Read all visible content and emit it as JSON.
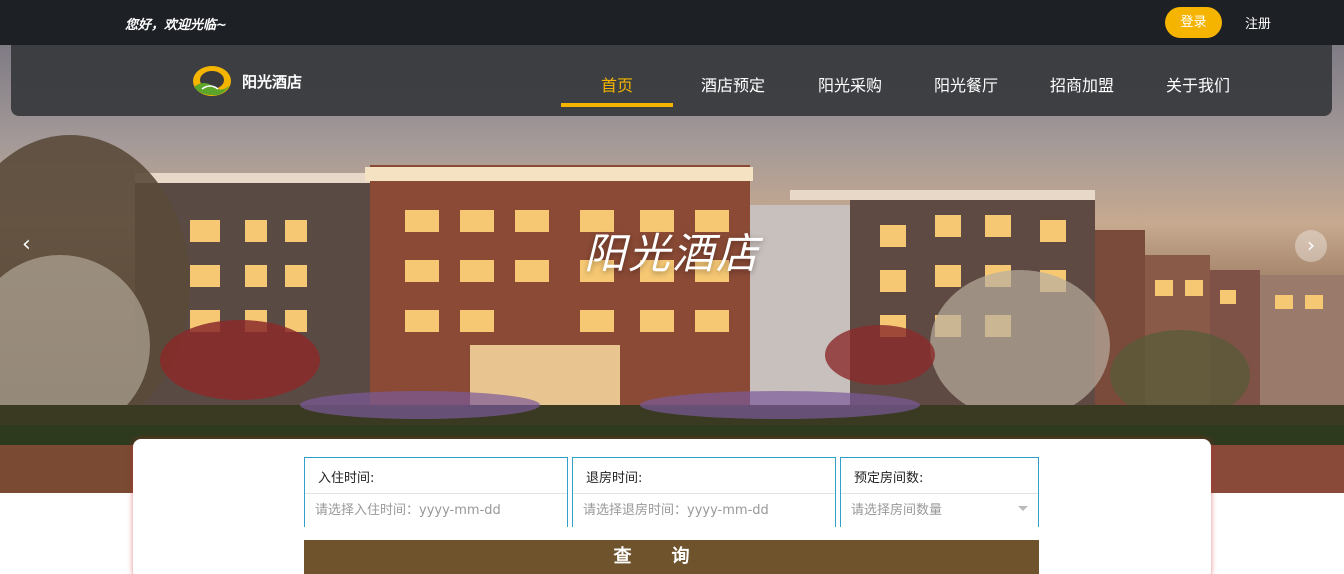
{
  "topbar": {
    "welcome": "您好，欢迎光临~",
    "login_label": "登录",
    "register_label": "注册"
  },
  "brand": {
    "name": "阳光酒店"
  },
  "nav": {
    "items": [
      {
        "label": "首页",
        "active": true
      },
      {
        "label": "酒店预定",
        "active": false
      },
      {
        "label": "阳光采购",
        "active": false
      },
      {
        "label": "阳光餐厅",
        "active": false
      },
      {
        "label": "招商加盟",
        "active": false
      },
      {
        "label": "关于我们",
        "active": false
      }
    ]
  },
  "hero": {
    "title": "阳光酒店",
    "prev_icon": "chevron-left-icon",
    "next_icon": "chevron-right-icon"
  },
  "search": {
    "checkin": {
      "label": "入住时间:",
      "placeholder": "请选择入住时间：yyyy-mm-dd"
    },
    "checkout": {
      "label": "退房时间:",
      "placeholder": "请选择退房时间：yyyy-mm-dd"
    },
    "rooms": {
      "label": "预定房间数:",
      "placeholder": "请选择房间数量"
    },
    "button_label": "查询"
  },
  "colors": {
    "accent": "#f5b400",
    "field_border": "#2fa0c8",
    "button": "#6e532d",
    "topbar": "#1d2025"
  }
}
